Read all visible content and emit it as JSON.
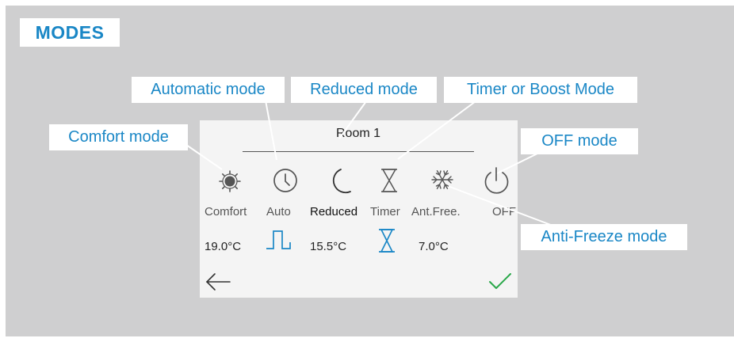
{
  "title": "MODES",
  "callouts": {
    "automatic": "Automatic mode",
    "reduced": "Reduced mode",
    "timer": "Timer or Boost Mode",
    "comfort": "Comfort mode",
    "off": "OFF mode",
    "antifreeze": "Anti-Freeze mode"
  },
  "screen": {
    "room_name": "Room 1",
    "modes": [
      {
        "id": "comfort",
        "label": "Comfort",
        "icon": "sun-icon"
      },
      {
        "id": "auto",
        "label": "Auto",
        "icon": "clock-icon"
      },
      {
        "id": "reduced",
        "label": "Reduced",
        "icon": "moon-icon"
      },
      {
        "id": "timer",
        "label": "Timer",
        "icon": "hourglass-icon"
      },
      {
        "id": "antifreeze",
        "label": "Ant.Free.",
        "icon": "snowflake-icon"
      },
      {
        "id": "off",
        "label": "OFF",
        "icon": "power-icon"
      }
    ],
    "temperatures": {
      "comfort": "19.0°C",
      "reduced": "15.5°C",
      "antifreeze": "7.0°C"
    },
    "selected_mode": "reduced",
    "back_icon": "back-arrow-icon",
    "confirm_icon": "checkmark-icon",
    "colors": {
      "accent": "#1a87c6",
      "confirm": "#2aa84a",
      "background": "#cfcfd0",
      "screen": "#f4f4f4"
    }
  }
}
